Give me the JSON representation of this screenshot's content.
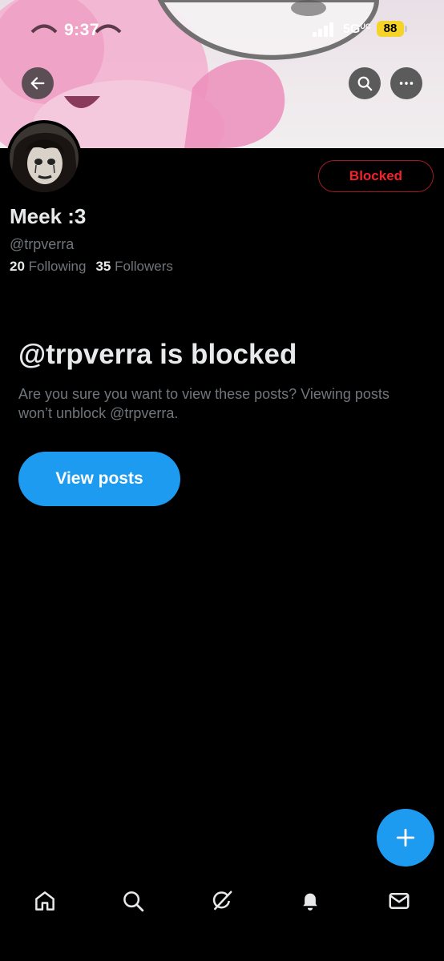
{
  "status_bar": {
    "time": "9:37",
    "network": "5G",
    "network_suffix": "UC",
    "battery": "88"
  },
  "header": {
    "back_icon": "back-arrow-icon",
    "search_icon": "search-icon",
    "more_icon": "more-icon"
  },
  "profile": {
    "display_name": "Meek :3",
    "handle": "@trpverra",
    "following_count": "20",
    "following_label": "Following",
    "followers_count": "35",
    "followers_label": "Followers",
    "blocked_button_label": "Blocked"
  },
  "blocked_notice": {
    "title": "@trpverra is blocked",
    "description": "Are you sure you want to view these posts? Viewing posts won’t unblock @trpverra.",
    "view_button_label": "View posts"
  },
  "tab_bar": {
    "items": [
      "home-icon",
      "search-icon",
      "grok-icon",
      "notifications-icon",
      "messages-icon"
    ]
  },
  "colors": {
    "accent": "#1d9bf0",
    "blocked_red": "#f4212e",
    "background": "#000000",
    "secondary_text": "#71767b"
  }
}
